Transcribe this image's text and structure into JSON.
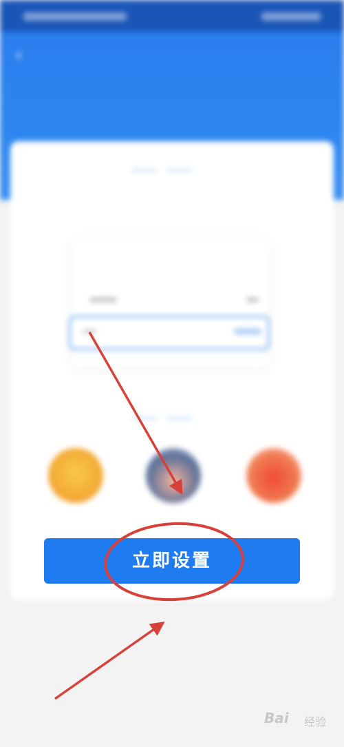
{
  "status_bar": {
    "left_text": "",
    "right_text": ""
  },
  "header": {
    "nav_title": "",
    "hero_title_main": "",
    "hero_title_highlight": ""
  },
  "card": {
    "section1_title": "",
    "section1_desc_line1": "",
    "section1_desc_accent": "",
    "section1_desc_line2": "",
    "mock_amount": "",
    "section2_title": "",
    "features": [
      {
        "label": ""
      },
      {
        "label": ""
      },
      {
        "label": ""
      }
    ]
  },
  "cta": {
    "label": "立即设置"
  },
  "watermark": {
    "brand": "Bai",
    "suffix": "经验"
  },
  "colors": {
    "header_blue": "#2a7dee",
    "cta_blue": "#1e7bf0",
    "highlight_yellow": "#e8f257",
    "annotation_red": "#d8413a"
  }
}
